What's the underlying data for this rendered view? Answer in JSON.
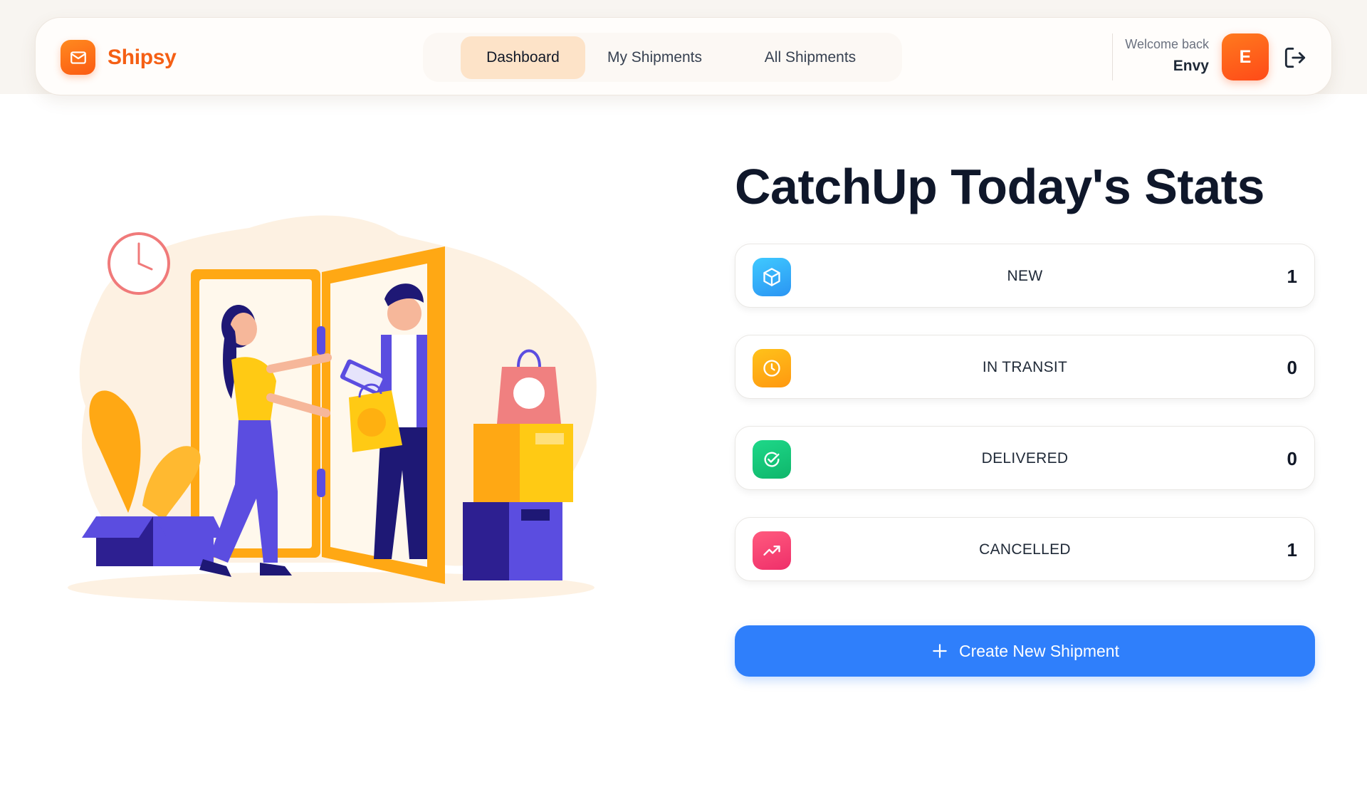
{
  "colors": {
    "brand": "#f55f14",
    "primary_button": "#2f7ffb",
    "active_tab": "#fde3c8",
    "new_icon": "#2bb7f5",
    "in_transit_icon": "#ffac12",
    "delivered_icon": "#14c77a",
    "cancelled_icon": "#f43f6e"
  },
  "header": {
    "brand_icon": "mail-icon",
    "brand_name": "Shipsy",
    "tabs": [
      {
        "label": "Dashboard",
        "active": true
      },
      {
        "label": "My Shipments",
        "active": false
      },
      {
        "label": "All Shipments",
        "active": false
      }
    ],
    "welcome_label": "Welcome back",
    "user_name": "Envy",
    "avatar_initial": "E",
    "logout_icon": "logout-icon"
  },
  "main": {
    "illustration": "delivery-illustration",
    "heading": "CatchUp Today's Stats",
    "stats": [
      {
        "label": "NEW",
        "value": "1",
        "icon": "box-icon"
      },
      {
        "label": "IN TRANSIT",
        "value": "0",
        "icon": "clock-icon"
      },
      {
        "label": "DELIVERED",
        "value": "0",
        "icon": "check-circle-icon"
      },
      {
        "label": "CANCELLED",
        "value": "1",
        "icon": "trending-up-icon"
      }
    ],
    "create_button_label": "Create New Shipment",
    "create_button_icon": "plus-icon"
  }
}
